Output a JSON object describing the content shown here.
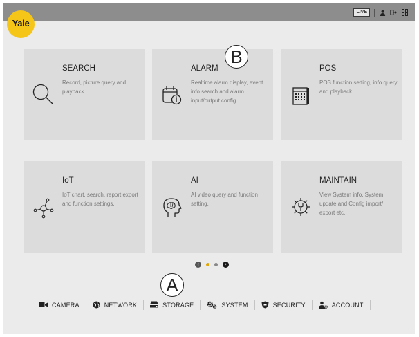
{
  "brand": {
    "logo_text": "Yale",
    "logo_color": "#f5c518"
  },
  "topbar": {
    "live_label": "LIVE",
    "icons": [
      "user-icon",
      "logout-icon",
      "menu-grid-icon"
    ]
  },
  "cards": [
    {
      "title": "SEARCH",
      "desc": "Record, picture query and playback.",
      "icon": "search-icon"
    },
    {
      "title": "ALARM",
      "desc": "Realtime alarm display, event info search and alarm input/output config.",
      "icon": "alarm-calendar-icon"
    },
    {
      "title": "POS",
      "desc": "POS function setting, info query and playback.",
      "icon": "pos-terminal-icon"
    },
    {
      "title": "IoT",
      "desc": "IoT chart, search, report export and function settings.",
      "icon": "iot-network-icon"
    },
    {
      "title": "AI",
      "desc": "AI video query and function setting.",
      "icon": "ai-head-icon"
    },
    {
      "title": "MAINTAIN",
      "desc": "View System info, System update and Config import/ export etc.",
      "icon": "maintain-gear-icon"
    }
  ],
  "pager": {
    "current_page": 1,
    "total_pages": 2,
    "active_color": "#e0a80c"
  },
  "bottom_nav": [
    {
      "label": "CAMERA",
      "icon": "camera-icon"
    },
    {
      "label": "NETWORK",
      "icon": "network-globe-icon"
    },
    {
      "label": "STORAGE",
      "icon": "storage-hdd-icon"
    },
    {
      "label": "SYSTEM",
      "icon": "system-gears-icon"
    },
    {
      "label": "SECURITY",
      "icon": "security-shield-icon"
    },
    {
      "label": "ACCOUNT",
      "icon": "account-user-icon"
    }
  ],
  "annotations": {
    "a": "A",
    "b": "B"
  }
}
